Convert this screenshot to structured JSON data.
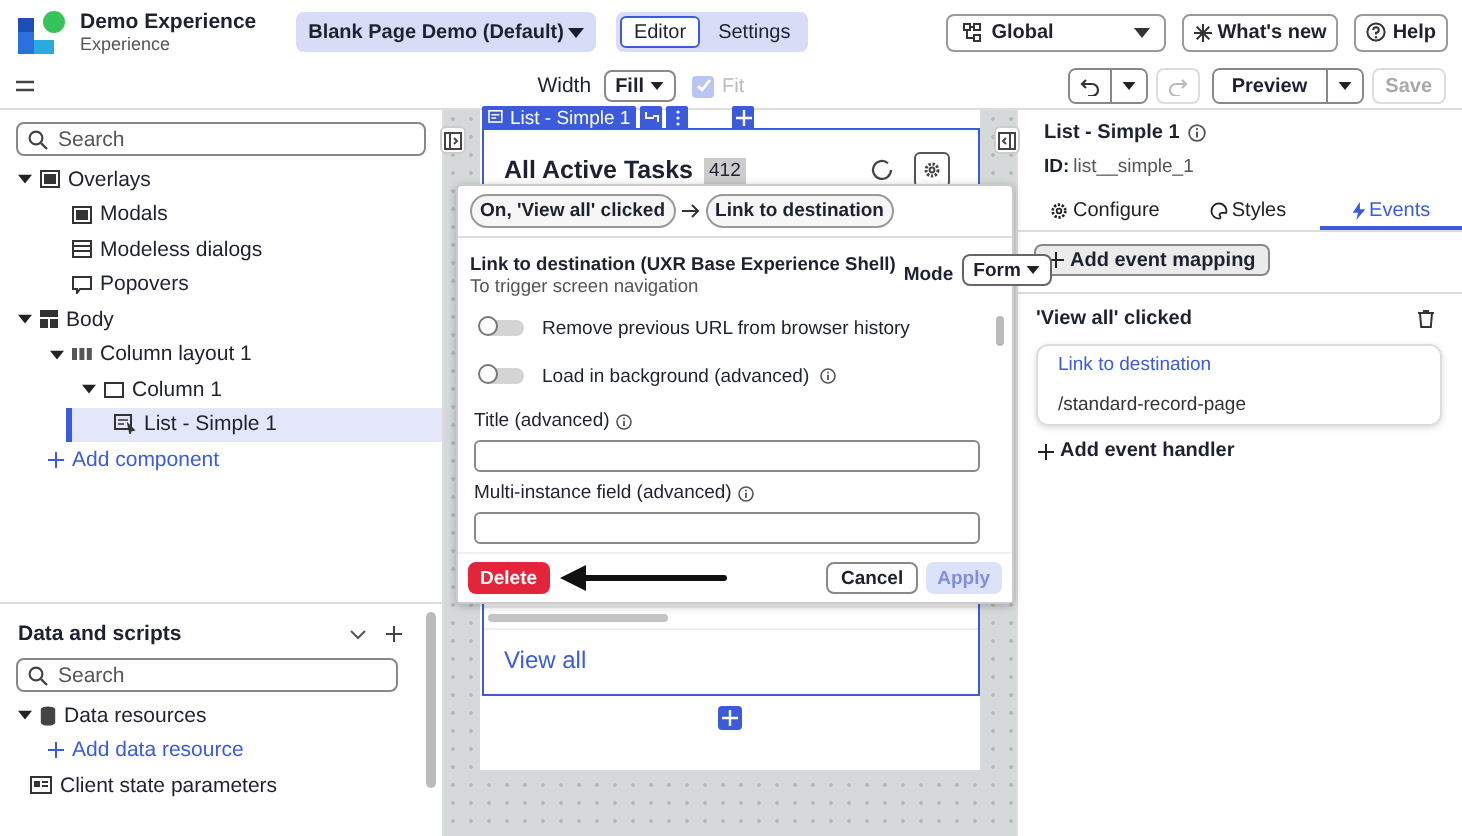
{
  "app": {
    "title": "Demo Experience",
    "subtitle": "Experience"
  },
  "page_selector": "Blank Page Demo (Default)",
  "mode_tabs": [
    {
      "label": "Editor",
      "selected": true
    },
    {
      "label": "Settings",
      "selected": false
    }
  ],
  "scope": "Global",
  "whats_new": "What's new",
  "help": "Help",
  "toolbar": {
    "width_label": "Width",
    "width_value": "Fill",
    "fit": {
      "label": "Fit",
      "checked": true,
      "disabled": true
    },
    "preview": "Preview",
    "save": {
      "label": "Save",
      "disabled": true
    }
  },
  "outline": {
    "search_placeholder": "Search",
    "tree": [
      {
        "label": "Overlays",
        "kind": "overlay",
        "expanded": true,
        "selected": false,
        "children": [
          {
            "label": "Modals",
            "kind": "modal",
            "selected": false
          },
          {
            "label": "Modeless dialogs",
            "kind": "dialog",
            "selected": false
          },
          {
            "label": "Popovers",
            "kind": "popover",
            "selected": false
          }
        ]
      },
      {
        "label": "Body",
        "kind": "body",
        "expanded": true,
        "selected": false,
        "children": [
          {
            "label": "Column layout 1",
            "kind": "layout",
            "expanded": true,
            "selected": false,
            "children": [
              {
                "label": "Column 1",
                "kind": "column",
                "expanded": true,
                "selected": false,
                "children": [
                  {
                    "label": "List - Simple 1",
                    "kind": "component",
                    "selected": true
                  }
                ]
              }
            ]
          }
        ]
      }
    ],
    "add_component": "Add component"
  },
  "data_scripts": {
    "title": "Data and scripts",
    "search_placeholder": "Search",
    "items": [
      {
        "label": "Data resources",
        "kind": "group",
        "expanded": true
      },
      {
        "label": "Add data resource",
        "kind": "add"
      },
      {
        "label": "Client state parameters",
        "kind": "params"
      }
    ]
  },
  "canvas": {
    "component_tag": "List - Simple 1",
    "card_title": "All Active Tasks",
    "card_count": "412",
    "view_all": "View all"
  },
  "popup": {
    "chips": [
      "On, 'View all' clicked",
      "Link to destination"
    ],
    "title": "Link to destination (UXR Base Experience Shell)",
    "subtitle": "To trigger screen navigation",
    "mode_label": "Mode",
    "mode_value": "Form",
    "toggles": [
      {
        "label": "Remove previous URL from browser history",
        "on": false,
        "info": false
      },
      {
        "label": "Load in background (advanced)",
        "on": false,
        "info": true
      }
    ],
    "fields": [
      {
        "label": "Title (advanced)",
        "info": true
      },
      {
        "label": "Multi-instance field (advanced)",
        "info": true
      }
    ],
    "delete": "Delete",
    "cancel": "Cancel",
    "apply": {
      "label": "Apply",
      "disabled": true
    }
  },
  "inspector": {
    "title": "List - Simple 1",
    "id_label": "ID:",
    "id_value": "list__simple_1",
    "tabs": [
      {
        "label": "Configure",
        "kind": "configure",
        "selected": false
      },
      {
        "label": "Styles",
        "kind": "styles",
        "selected": false
      },
      {
        "label": "Events",
        "kind": "events",
        "selected": true
      }
    ],
    "add_mapping": "Add event mapping",
    "event": "'View all' clicked",
    "handler": {
      "action": "Link to destination",
      "detail": "/standard-record-page"
    },
    "add_handler": "Add event handler"
  }
}
